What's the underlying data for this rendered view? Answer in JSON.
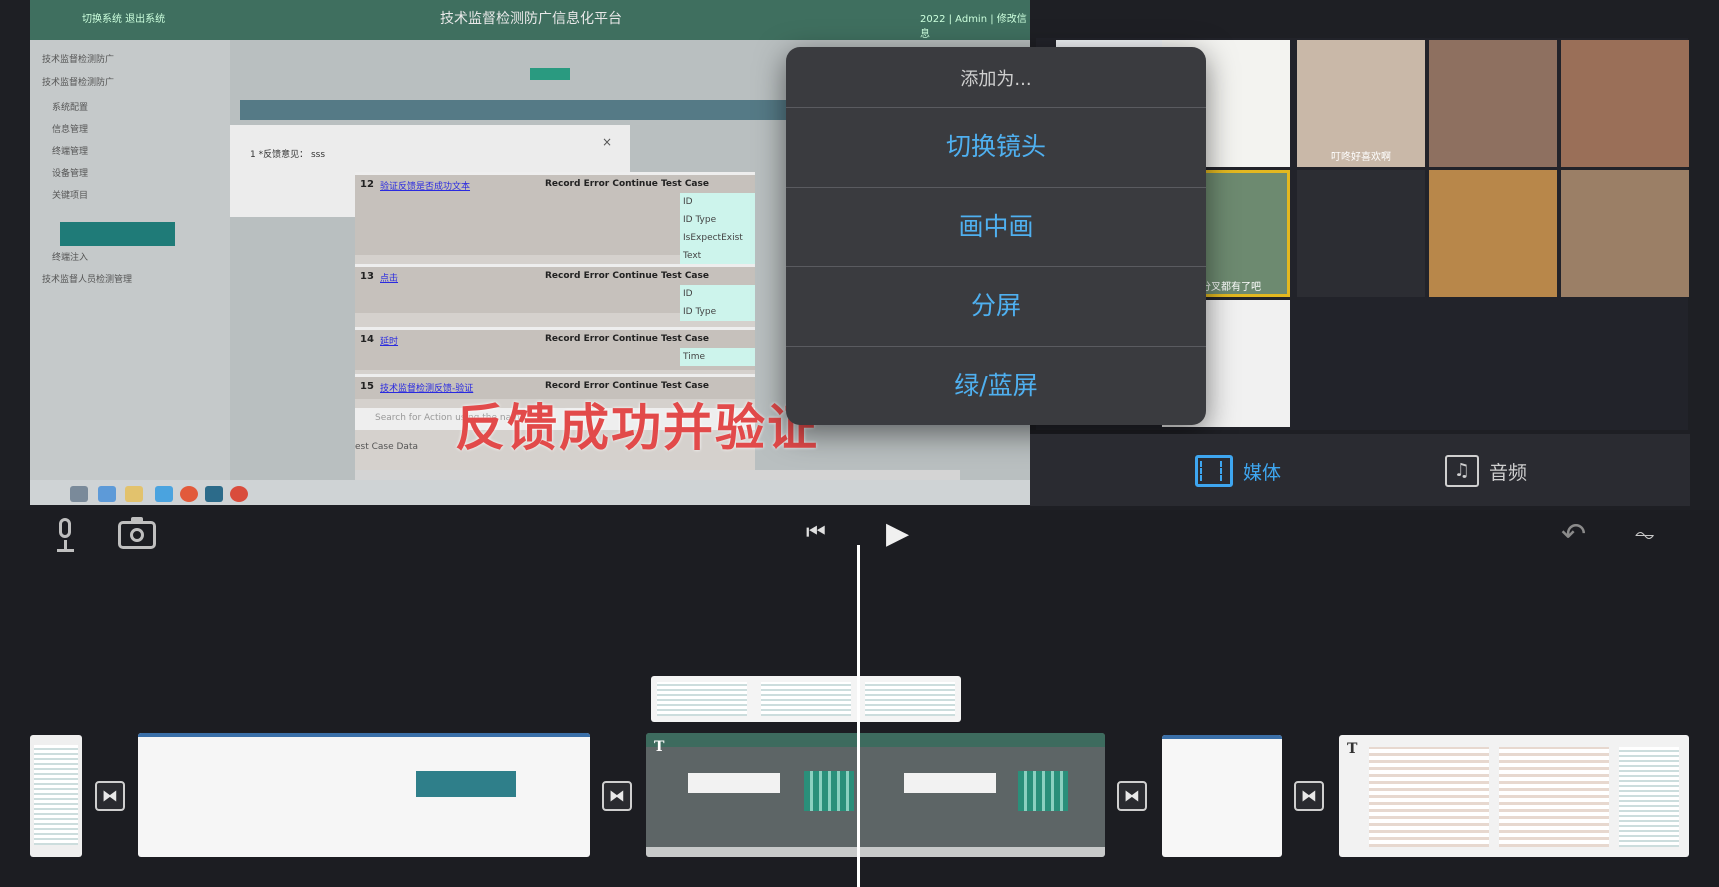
{
  "viewer": {
    "banner_title": "技术监督检测防广信息化平台",
    "banner_left": "切换系统  退出系统",
    "banner_right": "2022 | Admin | 修改信息",
    "sidebar_items": [
      "技术监督检测防广",
      "技术监督检测防广",
      "系统配置",
      "信息管理",
      "终端管理",
      "设备管理",
      "关键项目",
      "终端注入",
      "技术监督人员检测管理"
    ],
    "dialog_label": "1 *反馈意见：  sss",
    "rows": [
      {
        "num": "12",
        "link": "验证反馈是否成功文本",
        "action": "Record Error Continue Test Case",
        "params": [
          "ID",
          "ID Type",
          "IsExpectExist",
          "Text"
        ]
      },
      {
        "num": "13",
        "link": "点击",
        "action": "Record Error Continue Test Case",
        "params": [
          "ID",
          "ID Type"
        ]
      },
      {
        "num": "14",
        "link": "延时",
        "action": "Record Error Continue Test Case",
        "params": [
          "Time"
        ]
      },
      {
        "num": "15",
        "link": "技术监督检测反馈-验证",
        "action": "Record Error Continue Test Case",
        "params": []
      }
    ],
    "search_placeholder": "Search for Action using the name",
    "case_data": "est Case Data",
    "overlay_caption": "反馈成功并验证"
  },
  "popover": {
    "title": "添加为...",
    "options": [
      "切换镜头",
      "画中画",
      "分屏",
      "绿/蓝屏"
    ]
  },
  "media": {
    "thumbs": [
      {
        "caption": "",
        "color": "#eef1f4"
      },
      {
        "caption": "",
        "color": "#eef1f4"
      },
      {
        "caption": "",
        "color": "#c9b8a8"
      },
      {
        "caption": "",
        "color": "#8e7060"
      },
      {
        "caption": "",
        "color": "#9a6f58"
      },
      {
        "caption": "",
        "color": "#1a1b20"
      },
      {
        "caption": "",
        "color": "#6d8a70"
      },
      {
        "caption": "",
        "color": "#2c2d33"
      },
      {
        "caption": "",
        "color": "#b8874a"
      },
      {
        "caption": "",
        "color": "#9b7f66"
      },
      {
        "caption": "",
        "color": "#f1f1f1"
      }
    ],
    "captions": {
      "c3": "叮咚好喜欢啊",
      "c7": "是分叉都有了吧"
    },
    "tab_media": "媒体",
    "tab_audio": "音频"
  },
  "colors": {
    "accent": "#4fb0f0",
    "highlight": "#e3b820",
    "background": "#1e1f24"
  },
  "icons": {
    "mic": "microphone-icon",
    "camera": "camera-icon",
    "skip_back": "skip-to-start-icon",
    "play": "play-icon",
    "undo": "undo-icon",
    "waveform": "audio-waveform-icon",
    "transition": "transition-icon",
    "title": "title-icon"
  },
  "controls": {
    "skip_glyph": "⏮",
    "play_glyph": "▶",
    "undo_glyph": "↶",
    "wave_glyph": "⏦",
    "transition_glyph": "⧓",
    "title_glyph": "T"
  }
}
